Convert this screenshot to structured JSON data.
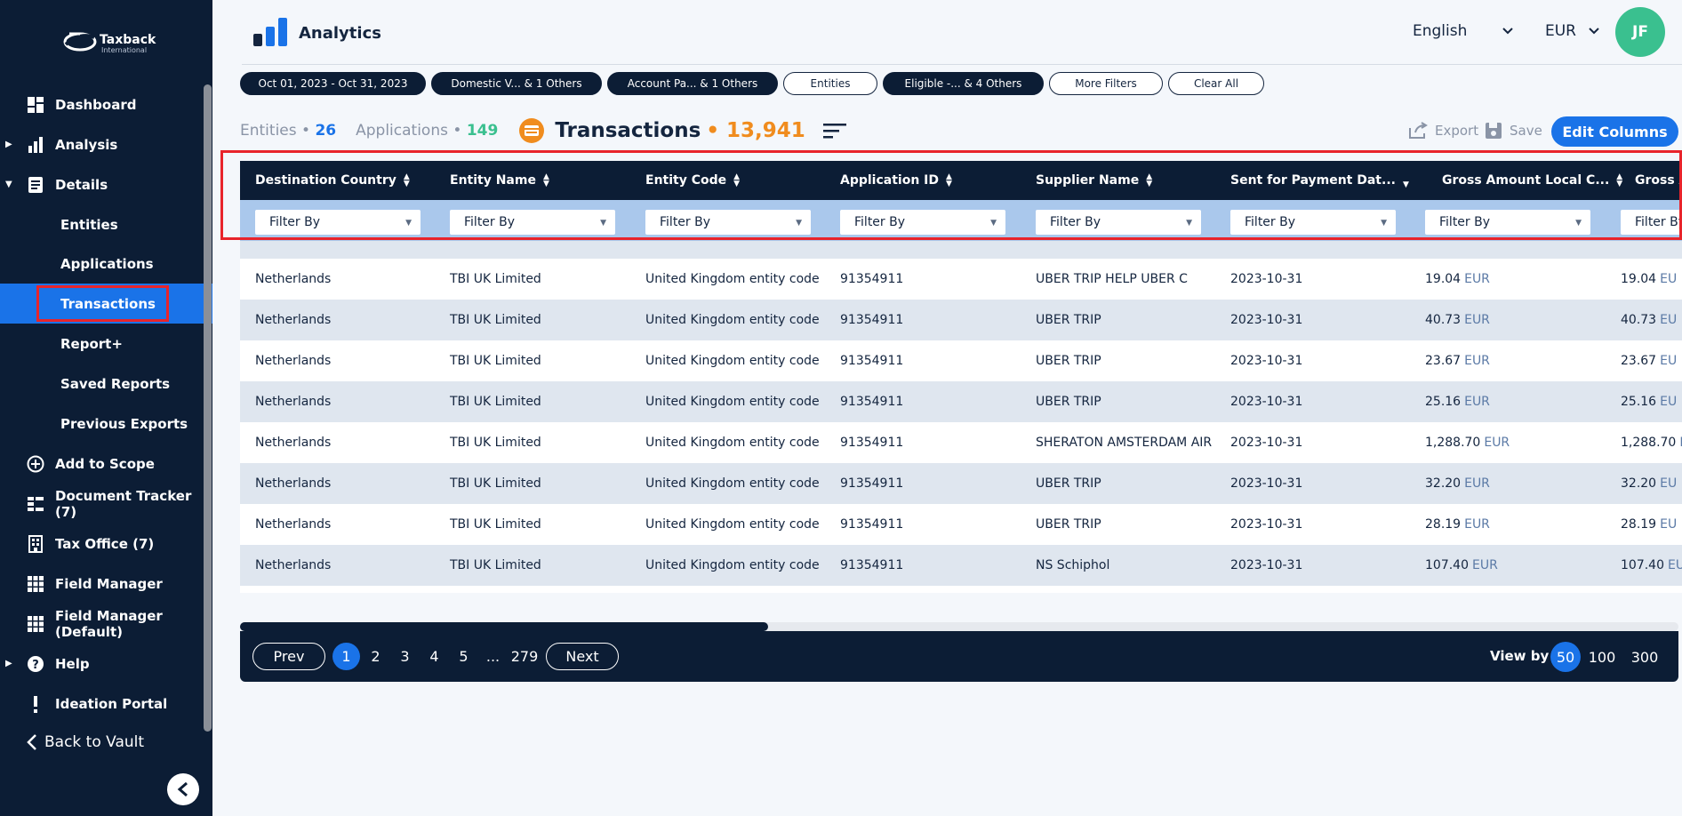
{
  "sidebar": {
    "logo_text": "Taxback",
    "logo_sub": "International",
    "items": [
      {
        "label": "Dashboard"
      },
      {
        "label": "Analysis"
      },
      {
        "label": "Details"
      },
      {
        "label": "Entities"
      },
      {
        "label": "Applications"
      },
      {
        "label": "Transactions"
      },
      {
        "label": "Report+"
      },
      {
        "label": "Saved Reports"
      },
      {
        "label": "Previous Exports"
      },
      {
        "label": "Add to Scope"
      },
      {
        "label": "Document Tracker (7)"
      },
      {
        "label": "Tax Office (7)"
      },
      {
        "label": "Field Manager"
      },
      {
        "label": "Field Manager (Default)"
      },
      {
        "label": "Help"
      },
      {
        "label": "Ideation Portal"
      }
    ],
    "back_label": "Back to Vault"
  },
  "header": {
    "title": "Analytics",
    "language": "English",
    "currency": "EUR",
    "avatar": "JF"
  },
  "filters": {
    "chips": [
      {
        "label": "Oct 01, 2023 - Oct 31, 2023",
        "style": "dark"
      },
      {
        "label": "Domestic V... & 1 Others",
        "style": "dark"
      },
      {
        "label": "Account Pa... & 1 Others",
        "style": "dark"
      },
      {
        "label": "Entities",
        "style": "light"
      },
      {
        "label": "Eligible -... & 4 Others",
        "style": "dark"
      },
      {
        "label": "More Filters",
        "style": "light"
      },
      {
        "label": "Clear All",
        "style": "light"
      }
    ]
  },
  "summary": {
    "entities_label": "Entities",
    "entities_count": "26",
    "applications_label": "Applications",
    "applications_count": "149",
    "transactions_label": "Transactions",
    "transactions_count": "13,941",
    "export_label": "Export",
    "save_label": "Save",
    "edit_columns_label": "Edit Columns"
  },
  "table": {
    "columns": [
      "Destination Country",
      "Entity Name",
      "Entity Code",
      "Application ID",
      "Supplier Name",
      "Sent for Payment Dat...",
      "Gross Amount Local C...",
      "Gross A"
    ],
    "filter_placeholder": "Filter By",
    "rows": [
      [
        "Netherlands",
        "TBI UK Limited",
        "United Kingdom entity code",
        "91354911",
        "UBER TRIP HELP UBER C",
        "2023-10-31",
        "19.04",
        "19.04"
      ],
      [
        "Netherlands",
        "TBI UK Limited",
        "United Kingdom entity code",
        "91354911",
        "UBER TRIP",
        "2023-10-31",
        "40.73",
        "40.73"
      ],
      [
        "Netherlands",
        "TBI UK Limited",
        "United Kingdom entity code",
        "91354911",
        "UBER TRIP",
        "2023-10-31",
        "23.67",
        "23.67"
      ],
      [
        "Netherlands",
        "TBI UK Limited",
        "United Kingdom entity code",
        "91354911",
        "UBER TRIP",
        "2023-10-31",
        "25.16",
        "25.16"
      ],
      [
        "Netherlands",
        "TBI UK Limited",
        "United Kingdom entity code",
        "91354911",
        "SHERATON AMSTERDAM AIR",
        "2023-10-31",
        "1,288.70",
        "1,288.70"
      ],
      [
        "Netherlands",
        "TBI UK Limited",
        "United Kingdom entity code",
        "91354911",
        "UBER TRIP",
        "2023-10-31",
        "32.20",
        "32.20"
      ],
      [
        "Netherlands",
        "TBI UK Limited",
        "United Kingdom entity code",
        "91354911",
        "UBER TRIP",
        "2023-10-31",
        "28.19",
        "28.19"
      ],
      [
        "Netherlands",
        "TBI UK Limited",
        "United Kingdom entity code",
        "91354911",
        "NS Schiphol",
        "2023-10-31",
        "107.40",
        "107.40"
      ]
    ],
    "currency_unit": "EUR",
    "last_col_unit": "EU"
  },
  "pagination": {
    "prev_label": "Prev",
    "next_label": "Next",
    "pages": [
      "1",
      "2",
      "3",
      "4",
      "5",
      "...",
      "279"
    ],
    "current": "1",
    "view_by_label": "View by",
    "view_by_options": [
      "50",
      "100",
      "300"
    ],
    "view_by_selected": "50"
  },
  "colors": {
    "navy": "#0c1d35",
    "accent_blue": "#1a73e8",
    "orange": "#f08c1e",
    "green": "#3ac08f",
    "highlight_red": "#e8242b"
  }
}
